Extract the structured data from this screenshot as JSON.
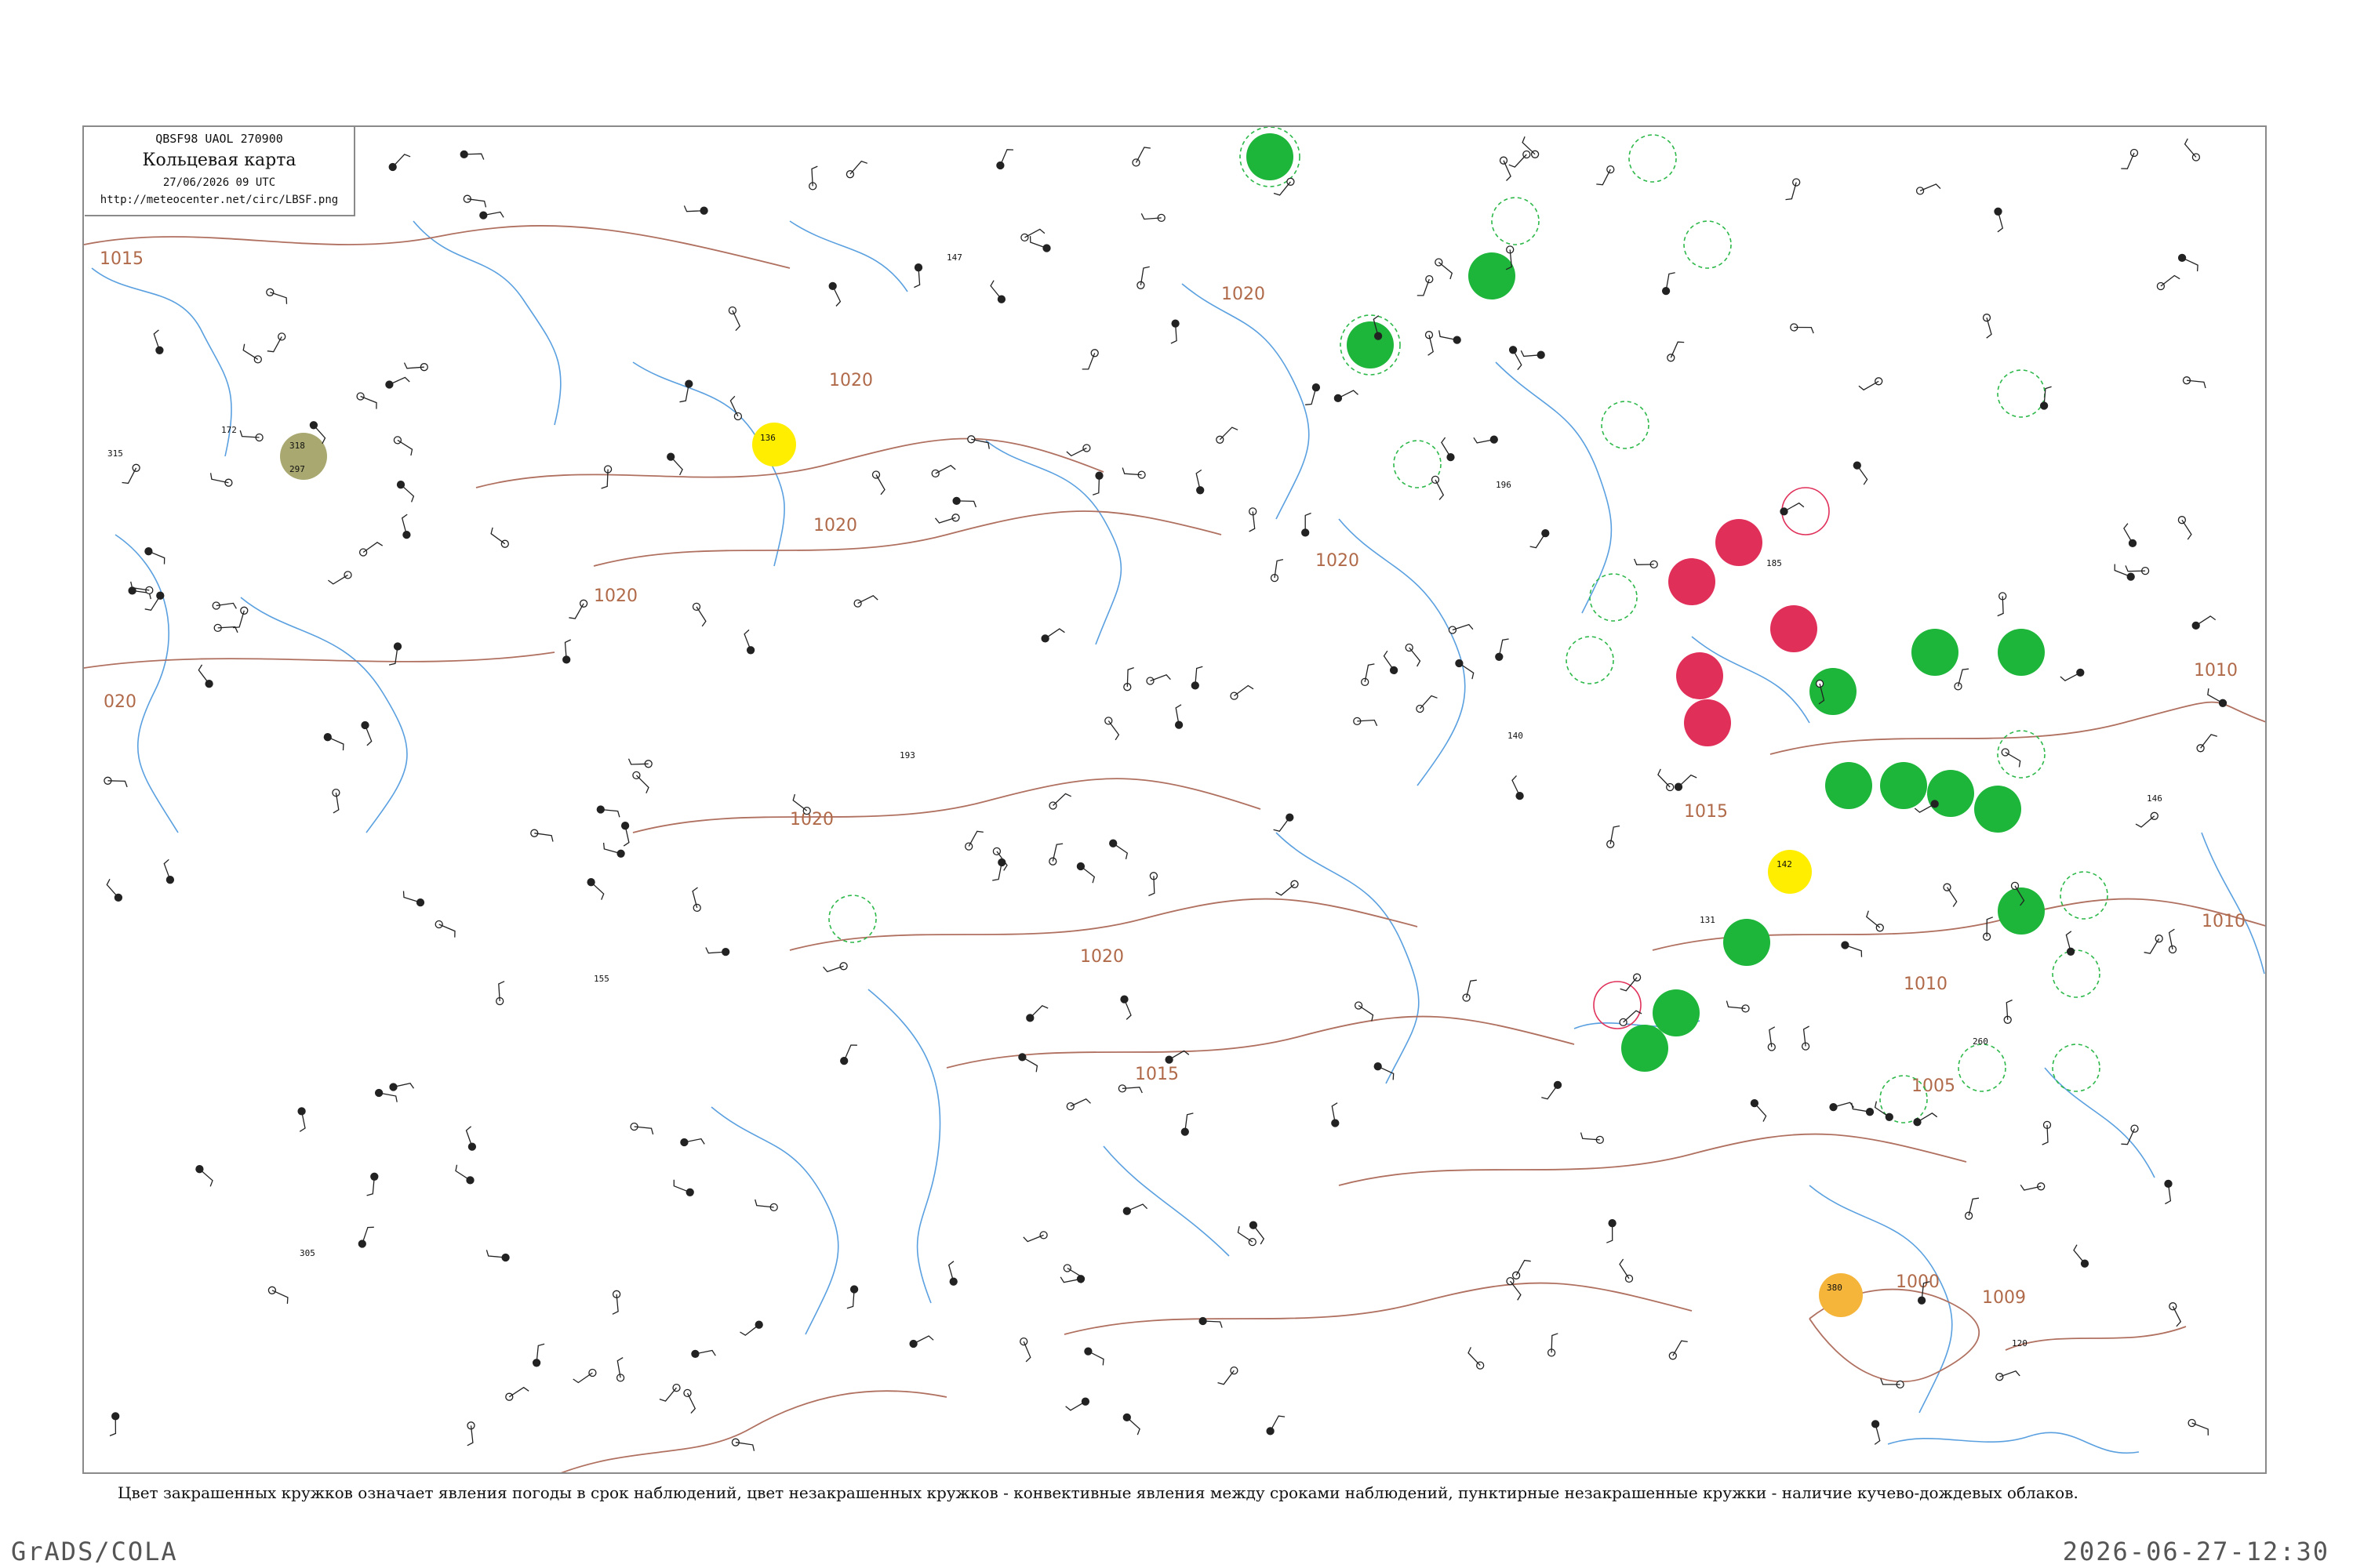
{
  "title_box": {
    "code": "QBSF98   UAOL   270900",
    "title": "Кольцевая карта",
    "time": "27/06/2026 09 UTC",
    "url": "http://meteocenter.net/circ/LBSF.png"
  },
  "isobar_labels": [
    "1015",
    "1020",
    "1020",
    "1020",
    "1020",
    "1020",
    "1020",
    "1020",
    "1015",
    "1015",
    "1010",
    "1010",
    "1010",
    "1005",
    "1000",
    "1009",
    "020"
  ],
  "station_samples": [
    "318",
    "136",
    "142",
    "380",
    "315",
    "172",
    "297",
    "155",
    "193",
    "146",
    "305",
    "196",
    "260",
    "185",
    "140",
    "120",
    "147",
    "131"
  ],
  "legend": {
    "caption": "Цвет закрашенных кружков означает явления погоды в срок наблюдений, цвет незакрашенных кружков - конвективные явления между сроками наблюдений, пунктирные незакрашенные кружки - наличие кучево-дождевых облаков."
  },
  "footer": {
    "left": "GrADS/COLA",
    "right": "2026-06-27-12:30"
  },
  "colors": {
    "isobar": "#b07060",
    "river": "#5aa0e0",
    "coast": "#5aa0e0",
    "frame": "#8a8a8a",
    "rain_green": "#1db53a",
    "thunder_red": "#e0305a",
    "haze_yellow": "#ffee00",
    "dust_orange": "#f5b53a",
    "mist_olive": "#a8a870",
    "cb_dashed": "#2db84a"
  }
}
